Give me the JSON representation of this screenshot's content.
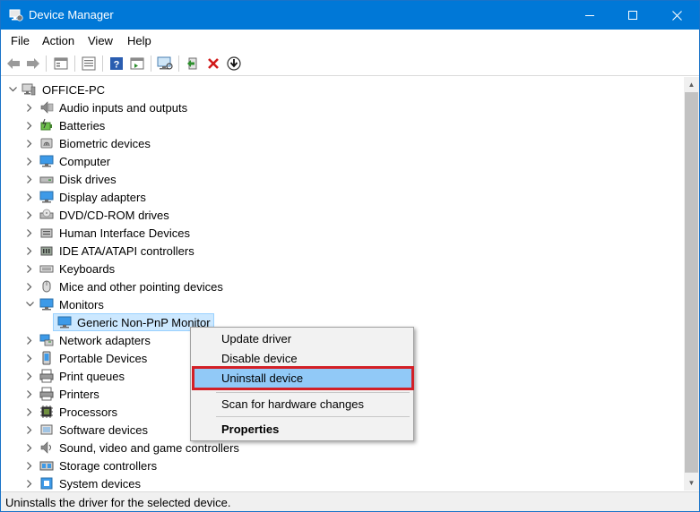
{
  "window": {
    "title": "Device Manager",
    "accent": "#0078d7"
  },
  "titlebar_controls": {
    "minimize": "—",
    "maximize": "☐",
    "close": "✕"
  },
  "menu": [
    "File",
    "Action",
    "View",
    "Help"
  ],
  "toolbar": {
    "icons": [
      "back-arrow-icon",
      "forward-arrow-icon",
      "properties-icon",
      "list-view-icon",
      "help-icon",
      "show-hidden-icon",
      "scan-monitor-icon",
      "update-driver-icon",
      "uninstall-x-icon",
      "download-icon"
    ]
  },
  "tree": {
    "root": "OFFICE-PC",
    "categories": [
      {
        "label": "Audio inputs and outputs",
        "icon": "speaker-icon"
      },
      {
        "label": "Batteries",
        "icon": "battery-icon"
      },
      {
        "label": "Biometric devices",
        "icon": "biometric-icon"
      },
      {
        "label": "Computer",
        "icon": "computer-icon"
      },
      {
        "label": "Disk drives",
        "icon": "disk-drive-icon"
      },
      {
        "label": "Display adapters",
        "icon": "display-adapter-icon"
      },
      {
        "label": "DVD/CD-ROM drives",
        "icon": "dvd-icon"
      },
      {
        "label": "Human Interface Devices",
        "icon": "hid-icon"
      },
      {
        "label": "IDE ATA/ATAPI controllers",
        "icon": "ide-icon"
      },
      {
        "label": "Keyboards",
        "icon": "keyboard-icon"
      },
      {
        "label": "Mice and other pointing devices",
        "icon": "mouse-icon"
      },
      {
        "label": "Monitors",
        "icon": "monitor-icon",
        "expanded": true
      },
      {
        "label": "Network adapters",
        "icon": "network-icon"
      },
      {
        "label": "Portable Devices",
        "icon": "portable-device-icon"
      },
      {
        "label": "Print queues",
        "icon": "print-queue-icon"
      },
      {
        "label": "Printers",
        "icon": "printer-icon"
      },
      {
        "label": "Processors",
        "icon": "processor-icon"
      },
      {
        "label": "Software devices",
        "icon": "software-device-icon"
      },
      {
        "label": "Sound, video and game controllers",
        "icon": "sound-icon"
      },
      {
        "label": "Storage controllers",
        "icon": "storage-icon"
      },
      {
        "label": "System devices",
        "icon": "system-device-icon"
      }
    ],
    "monitor_child": "Generic Non-PnP Monitor"
  },
  "context_menu": {
    "items": [
      "Update driver",
      "Disable device",
      "Uninstall device",
      "Scan for hardware changes",
      "Properties"
    ],
    "highlighted": "Uninstall device",
    "highlight_border_color": "#d32027"
  },
  "status": "Uninstalls the driver for the selected device."
}
